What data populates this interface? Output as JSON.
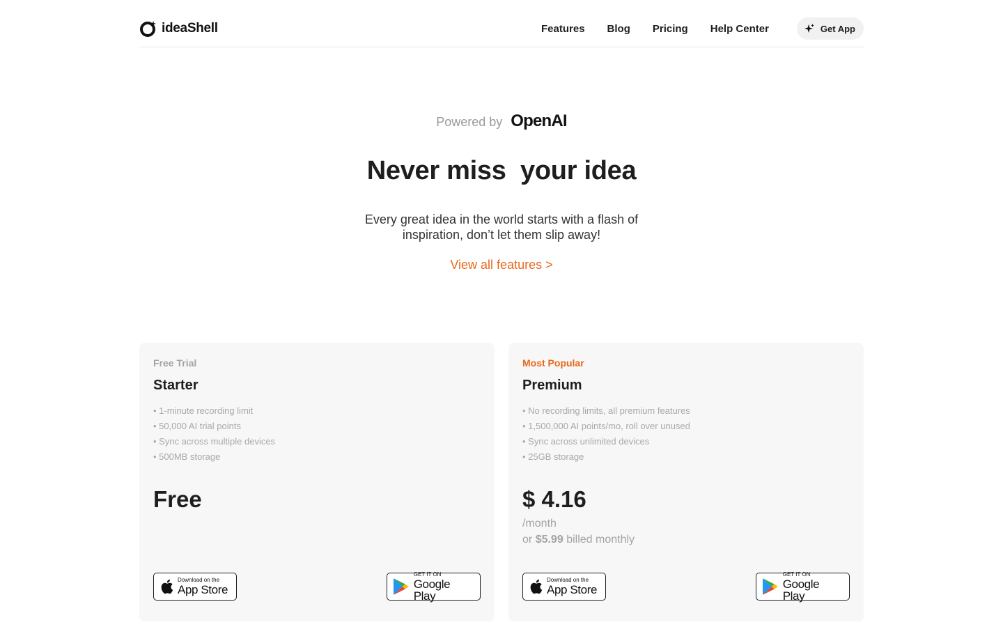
{
  "brand": {
    "name": "ideaShell"
  },
  "nav": {
    "items": [
      "Features",
      "Blog",
      "Pricing",
      "Help Center"
    ],
    "get_app": "Get App"
  },
  "hero": {
    "powered_by": "Powered by",
    "partner": "OpenAI",
    "title": "Never miss  your idea",
    "subtitle": "Every great idea in the world starts with a flash of inspiration, don’t let them slip away!",
    "link": "View all features >"
  },
  "plans": [
    {
      "tag": "Free Trial",
      "name": "Starter",
      "features": [
        "• 1-minute recording limit",
        "• 50,000 AI trial points",
        "• Sync across multiple devices",
        "• 500MB storage"
      ],
      "price": "Free"
    },
    {
      "tag": "Most Popular",
      "name": "Premium",
      "features": [
        "• No recording limits, all premium features",
        "• 1,500,000 AI points/mo, roll over unused",
        "• Sync across unlimited devices",
        "• 25GB storage"
      ],
      "price": "$ 4.16",
      "period": "/month",
      "billed_prefix": "or",
      "billed_amount": "$5.99",
      "billed_suffix": "billed monthly"
    }
  ],
  "badges": {
    "apple_small": "Download on the",
    "apple_big": "App Store",
    "google_small": "GET IT ON",
    "google_big": "Google Play"
  },
  "colors": {
    "accent": "#e8681a",
    "card_bg": "#f7f7f7"
  },
  "icons": [
    "ideashell-logo-icon",
    "sparkle-icon",
    "apple-icon",
    "google-play-icon"
  ]
}
